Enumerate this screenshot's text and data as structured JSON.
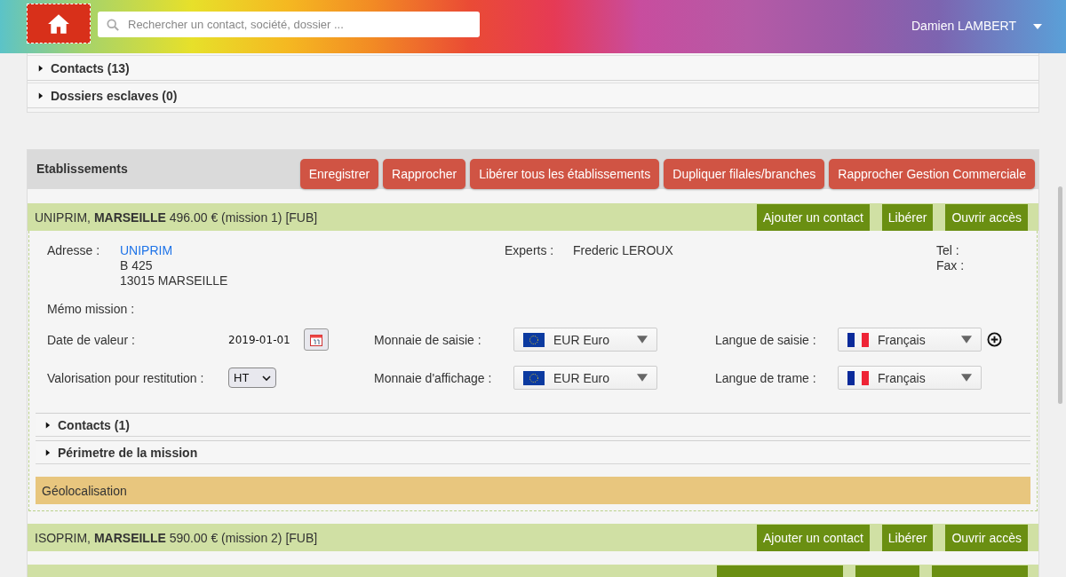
{
  "header": {
    "search": {
      "placeholder": "Rechercher un contact, société, dossier ..."
    },
    "user": {
      "name": "Damien LAMBERT"
    }
  },
  "sections": [
    {
      "label": "Contacts (13)",
      "expanded": false
    },
    {
      "label": "Dossiers esclaves (0)",
      "expanded": false
    }
  ],
  "etablissements": {
    "title": "Etablissements",
    "buttons": [
      "Enregistrer",
      "Rapprocher",
      "Libérer tous les établissements",
      "Dupliquer filales/branches",
      "Rapprocher Gestion Commerciale"
    ],
    "items": [
      {
        "title": "UNIPRIM, **MARSEILLE** 496.00 € (mission 1) [FUB]",
        "buttons": [
          "Ajouter un contact",
          "Libérer",
          "Ouvrir accès"
        ],
        "details": {
          "address_label": "Adresse :",
          "address_link": "UNIPRIM",
          "address_lines": [
            "B 425",
            "13015 MARSEILLE"
          ],
          "experts_label": "Experts :",
          "experts": "Frederic LEROUX",
          "tel_label": "Tel :",
          "fax_label": "Fax :",
          "memo_label": "Mémo mission :",
          "date_label": "Date de valeur :",
          "date_value": "2019-01-01",
          "valorisation_label": "Valorisation pour restitution :",
          "valorisation_value": "HT",
          "selects": [
            {
              "label": "Monnaie de saisie :",
              "value": "EUR Euro",
              "kind": "eu",
              "add": false
            },
            {
              "label": "Langue de saisie :",
              "value": "Français",
              "kind": "fr",
              "add": true
            },
            {
              "label": "Monnaie d'affichage :",
              "value": "EUR Euro",
              "kind": "eu",
              "add": false
            },
            {
              "label": "Langue de trame :",
              "value": "Français",
              "kind": "fr",
              "add": false
            }
          ],
          "subsections": [
            {
              "label": "Contacts (1)",
              "expanded": false
            },
            {
              "label": "Périmetre de la mission",
              "expanded": false
            }
          ],
          "geoloc": "Géolocalisation"
        }
      },
      {
        "title": "ISOPRIM, **MARSEILLE** 590.00 € (mission 2) [FUB]",
        "buttons": [
          "Ajouter un contact",
          "Libérer",
          "Ouvrir accès"
        ]
      }
    ]
  }
}
